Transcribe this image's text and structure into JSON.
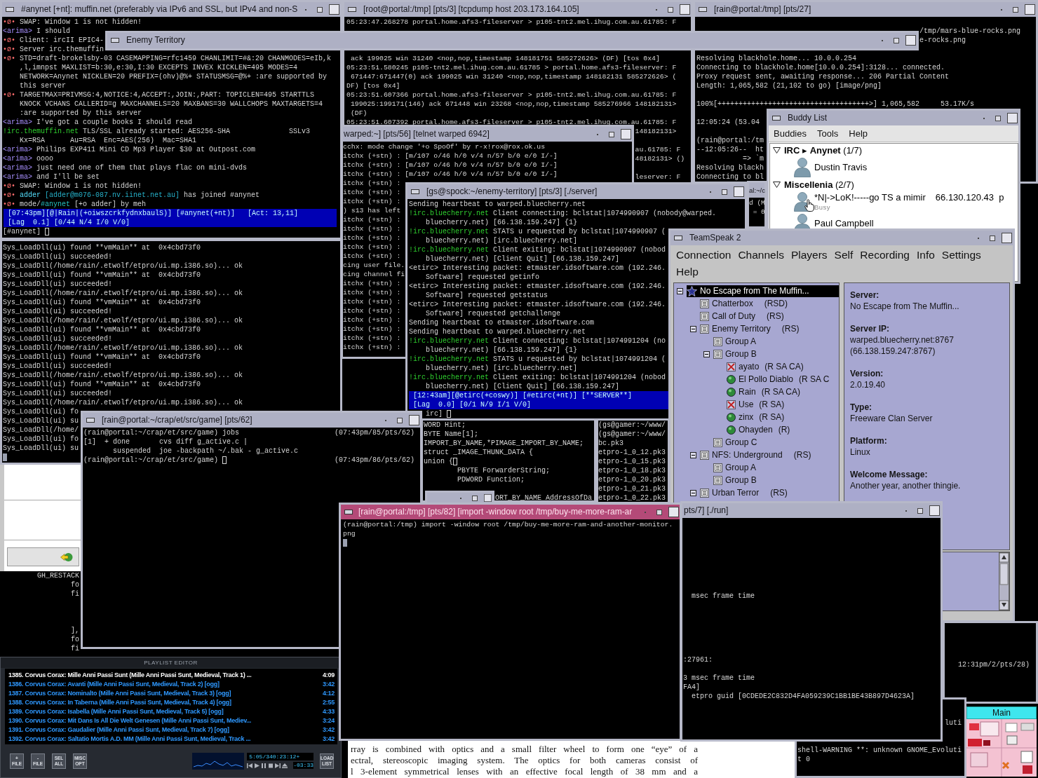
{
  "windows": [
    {
      "kind": "terminal",
      "title": "#anynet [+nt]: muffin.net (preferably via IPv6 and SSL, but IPv4 and non-S",
      "focused": false,
      "lines": [
        [
          {
            "kind": "mark",
            "text": "•ø•"
          },
          {
            "kind": "plain",
            "text": " SWAP: Window 1 is not hidden!"
          }
        ],
        [
          {
            "kind": "nick",
            "text": "<arima>"
          },
          {
            "kind": "plain",
            "text": " I should"
          }
        ],
        [
          {
            "kind": "mark",
            "text": "•ø•"
          },
          {
            "kind": "plain",
            "text": " Client: ircII EPIC4-"
          }
        ],
        [
          {
            "kind": "mark",
            "text": "•ø•"
          },
          {
            "kind": "plain",
            "text": " Server irc.themuffin"
          }
        ],
        [
          {
            "kind": "mark",
            "text": "•ø•"
          },
          {
            "kind": "plain",
            "text": " STD=draft-brokelsby-03 CASEMAPPING=rfc1459 CHANLIMIT=#&:20 CHANMODES=eIb,k"
          }
        ],
        "    ,l,imnpst MAXLIST=b:30,e:30,I:30 EXCEPTS INVEX KICKLEN=495 MODES=4",
        "    NETWORK=Anynet NICKLEN=20 PREFIX=(ohv)@%+ STATUSMSG=@%+ :are supported by",
        "    this server",
        [
          {
            "kind": "mark",
            "text": "•ø•"
          },
          {
            "kind": "plain",
            "text": " TARGETMAX=PRIVMSG:4,NOTICE:4,ACCEPT:,JOIN:,PART: TOPICLEN=495 STARTTLS"
          }
        ],
        "    KNOCK VCHANS CALLERID=g MAXCHANNELS=20 MAXBANS=30 WALLCHOPS MAXTARGETS=4",
        "    :are supported by this server",
        [
          {
            "kind": "nick",
            "text": "<arima>"
          },
          {
            "kind": "plain",
            "text": " I've got a couple books I should read"
          }
        ],
        [
          {
            "kind": "host",
            "text": "!irc.themuffin.net"
          },
          {
            "kind": "plain",
            "text": " TLS/SSL already started: AES256-SHA              SSLv3"
          }
        ],
        "    Kx=RSA      Au=RSA  Enc=AES(256)  Mac=SHA1",
        [
          {
            "kind": "nick",
            "text": "<arima>"
          },
          {
            "kind": "plain",
            "text": " Philips EXP411 Mini CD Mp3 Player $30 at Outpost.com"
          }
        ],
        [
          {
            "kind": "nick",
            "text": "<arima>"
          },
          {
            "kind": "plain",
            "text": " oooo"
          }
        ],
        [
          {
            "kind": "nick",
            "text": "<arima>"
          },
          {
            "kind": "plain",
            "text": " just need one of them that plays flac on mini-dvds"
          }
        ],
        [
          {
            "kind": "nick",
            "text": "<arima>"
          },
          {
            "kind": "plain",
            "text": " and I'll be set"
          }
        ],
        [
          {
            "kind": "mark",
            "text": "•ø•"
          },
          {
            "kind": "plain",
            "text": " SWAP: Window 1 is not hidden!"
          }
        ],
        [
          {
            "kind": "mark",
            "text": "•ø•"
          },
          {
            "kind": "joinnick",
            "text": " adder"
          },
          {
            "kind": "joinhost",
            "text": " [adder@m076-087.nv.iinet.net.au]"
          },
          {
            "kind": "plain",
            "text": " has joined #anynet"
          }
        ],
        [
          {
            "kind": "mark",
            "text": "•ø•"
          },
          {
            "kind": "plain",
            "text": " mode/"
          },
          {
            "kind": "channel",
            "text": "#anynet"
          },
          {
            "kind": "plain",
            "text": " [+o adder] by meh"
          }
        ]
      ],
      "status_bar": [
        "[07:43pm][@|Rain|(+oiwszcrkfydnxbaulS)] [#anynet(+nt)]   [Act: 13,11]",
        "[Lag  0.1] [0/44 N/4 I/0 V/0]"
      ],
      "input": {
        "text": "[#anynet] ",
        "cursor": {
          "kind": "outline"
        }
      }
    },
    {
      "kind": "shaded",
      "title": "Enemy Territory",
      "focused": false
    },
    {
      "kind": "terminal",
      "title": "[root@portal:/tmp] [pts/3] [tcpdump host 203.173.164.105]",
      "focused": false,
      "lines": [
        "05:23:47.268278 portal.home.afs3-fileserver > p105-tnt2.mel.ihug.com.au.61785: F",
        " ack 199025 win 31240 <nop,nop,timestamp 148181751 585272626> (DF) [tos 0x4]",
        "05:23:51.580245 p105-tnt2.mel.ihug.com.au.61785 > portal.home.afs3-fileserver: F",
        " 671447:671447(0) ack 199025 win 31240 <nop,nop,timestamp 148182131 585272626> (",
        "DF) [tos 0x4]",
        "05:23:51.607366 portal.home.afs3-fileserver > p105-tnt2.mel.ihug.com.au.61785: F",
        " 199025:199171(146) ack 671448 win 23268 <nop,nop,timestamp 585276966 148182131>",
        " (DF)",
        "05:23:51.607392 portal.home.afs3-fileserver > p105-tnt2.mel.ihug.com.au.61785: F",
        "148182131>",
        "au.61785: F",
        "48182131> ()",
        "leserver: F"
      ]
    },
    {
      "kind": "terminal",
      "title": "[rain@portal:/tmp] [pts/27]",
      "focused": false,
      "lines": [
        "/tmp/mars-blue-rocks.png",
        "e-rocks.png",
        "Resolving blackhole.home... 10.0.0.254",
        "Connecting to blackhole.home[10.0.0.254]:3128... connected.",
        "Proxy request sent, awaiting response... 206 Partial Content",
        "Length: 1,065,582 (21,102 to go) [image/png]",
        "100%[++++++++++++++++++++++++++++++++++++>] 1,065,582     53.17K/s",
        "12:05:24 (53.04",
        "(rain@portal:/tm",
        "--12:05:26--  ht",
        "           => `m",
        "Resolving blackh",
        "Connecting to bl"
      ]
    },
    {
      "kind": "buddy_list",
      "title": "Buddy List",
      "focused": false,
      "menu": [
        "Buddies",
        "Tools",
        "Help"
      ],
      "groups": [
        {
          "label": "**IRC** ▸ **Anynet** (1/7)",
          "expanded": true,
          "buddies": [
            {
              "name": "Dustin Travis"
            }
          ]
        },
        {
          "label": "**Miscellenia** (2/7)",
          "expanded": true,
          "buddies": [
            {
              "name": "*N|->LoK!-----go TS a mimir",
              "note": "66.130.120.43  p",
              "status": "Busy"
            },
            {
              "name": "Paul Campbell"
            }
          ]
        }
      ]
    },
    {
      "kind": "terminal",
      "title": "warped:~] [pts/56] [telnet warped 6942]",
      "focused": false,
      "lines": [
        "cchx: mode change '+o SpoOf' by r-x!rox@rox.ok.us",
        "itchx (+stn) : [m/107 o/46 h/0 v/4 n/57 b/0 e/0 I/-]",
        "itchx (+stn) : [m/107 o/46 h/0 v/4 n/57 b/0 e/0 I/-]",
        "itchx (+stn) : [m/107 o/46 h/0 v/4 n/57 b/0 e/0 I/-]",
        "itchx (+stn) :",
        "itchx (+stn) :",
        "itchx (+stn) :",
        ") s13 has left",
        "itchx (+stn) :",
        "itchx (+stn) :",
        "itchx (+stn) :",
        "itchx (+stn) :",
        "itchx (+stn) :",
        "cing user file.",
        "cing channel fi",
        "itchx (+stn) :",
        "itchx (+stn) :",
        "itchx (+stn) :",
        "itchx (+stn) :",
        "itchx (+stn) :",
        "itchx (+stn) :",
        "itchx (+stn) :",
        "itchx (+stn) :"
      ]
    },
    {
      "kind": "terminal",
      "title": "[gs@spock:~/enemy-territory] [pts/3] [./server]",
      "focused": false,
      "lines": [
        "Sending heartbeat to warped.bluecherry.net",
        [
          {
            "kind": "host",
            "text": "!irc.bluecherry.net"
          },
          {
            "kind": "plain",
            "text": " Client connecting: bclstat|1074990907 (nobody@warped."
          }
        ],
        "    bluecherry.net) [66.138.159.247] {1}",
        [
          {
            "kind": "host",
            "text": "!irc.bluecherry.net"
          },
          {
            "kind": "plain",
            "text": " STATS u requested by bclstat|1074990907 ("
          }
        ],
        "    bluecherry.net) [irc.bluecherry.net]",
        [
          {
            "kind": "host",
            "text": "!irc.bluecherry.net"
          },
          {
            "kind": "plain",
            "text": " Client exiting: bclstat|1074990907 (nobod"
          }
        ],
        "    bluecherry.net) [Client Quit] [66.138.159.247]",
        "<etirc> Interesting packet: etmaster.idsoftware.com (192.246.",
        "    Software] requested getinfo",
        "<etirc> Interesting packet: etmaster.idsoftware.com (192.246.",
        "    Software] requested getstatus",
        "<etirc> Interesting packet: etmaster.idsoftware.com (192.246.",
        "    Software] requested getchallenge",
        "Sending heartbeat to etmaster.idsoftware.com",
        "Sending heartbeat to warped.bluecherry.net",
        [
          {
            "kind": "host",
            "text": "!irc.bluecherry.net"
          },
          {
            "kind": "plain",
            "text": " Client connecting: bclstat|1074991204 (no"
          }
        ],
        "    bluecherry.net) [66.138.159.247] {1}",
        [
          {
            "kind": "host",
            "text": "!irc.bluecherry.net"
          },
          {
            "kind": "plain",
            "text": " STATS u requested by bclstat|1074991204 ("
          }
        ],
        "    bluecherry.net) [irc.bluecherry.net]",
        [
          {
            "kind": "host",
            "text": "!irc.bluecherry.net"
          },
          {
            "kind": "plain",
            "text": " Client exiting: bclstat|1074991204 (nobod"
          }
        ],
        "    bluecherry.net) [Client Quit] [66.138.159.247]"
      ],
      "status_bar": [
        "[12:43am][@etirc(+coswy)] [#etirc(+nt)] [**SERVER**]",
        "[Lag  0.0] [0/1 N/9 I/1 V/0]"
      ],
      "input": {
        "text": "irc] ",
        "cursor": {
          "kind": "outline"
        }
      }
    },
    {
      "kind": "terminal",
      "title": "al:~/c",
      "focused": false,
      "lines": [
        "d (M",
        "= 0"
      ]
    },
    {
      "kind": "terminal",
      "lines": [
        "Sys_LoadDll(ui) found **vmMain** at  0x4cbd73f0",
        "Sys_LoadDll(ui) succeeded!",
        "Sys_LoadDll(/home/rain/.etwolf/etpro/ui.mp.i386.so)... ok",
        "Sys_LoadDll(ui) found **vmMain** at  0x4cbd73f0",
        "Sys_LoadDll(ui) succeeded!",
        "Sys_LoadDll(/home/rain/.etwolf/etpro/ui.mp.i386.so)... ok",
        "Sys_LoadDll(ui) found **vmMain** at  0x4cbd73f0",
        "Sys_LoadDll(ui) succeeded!",
        "Sys_LoadDll(/home/rain/.etwolf/etpro/ui.mp.i386.so)... ok",
        "Sys_LoadDll(ui) found **vmMain** at  0x4cbd73f0",
        "Sys_LoadDll(ui) succeeded!",
        "Sys_LoadDll(/home/rain/.etwolf/etpro/ui.mp.i386.so)... ok",
        "Sys_LoadDll(ui) found **vmMain** at  0x4cbd73f0",
        "Sys_LoadDll(ui) succeeded!",
        "Sys_LoadDll(/home/rain/.etwolf/etpro/ui.mp.i386.so)... ok",
        "Sys_LoadDll(ui) found **vmMain** at  0x4cbd73f0",
        "Sys_LoadDll(ui) succeeded!",
        "Sys_LoadDll(/home/rain/.etwolf/etpro/ui.mp.i386.so)... ok",
        "Sys_LoadDll(ui) fo",
        "Sys_LoadDll(ui) su",
        "Sys_LoadDll(/home/",
        "Sys_LoadDll(ui) fo",
        "Sys_LoadDll(ui) su",
        {
          "cursor": {
            "kind": "block"
          }
        }
      ]
    },
    {
      "kind": "teamspeak",
      "title": "TeamSpeak 2",
      "focused": false,
      "menu": [
        "Connection",
        "Channels",
        "Players",
        "Self",
        "Recording",
        "Info",
        "Settings",
        "Help"
      ],
      "tree": [
        {
          "kind": "server",
          "name": "No Escape from The Muffin...",
          "selected": true,
          "expanded": true,
          "children": [
            {
              "kind": "channel",
              "name": "Chatterbox",
              "flags": "(RSD)",
              "selected": false
            },
            {
              "kind": "channel",
              "name": "Call of Duty",
              "flags": "(RS)",
              "selected": false
            },
            {
              "kind": "channel",
              "name": "Enemy Territory",
              "flags": "(RS)",
              "selected": false,
              "expanded": true,
              "children": [
                {
                  "kind": "channel",
                  "name": "Group A",
                  "selected": false
                },
                {
                  "kind": "channel",
                  "name": "Group B",
                  "selected": false,
                  "expanded": true,
                  "children": [
                    {
                      "kind": "player",
                      "name": "ayato",
                      "flags": "(R SA CA)",
                      "selected": false,
                      "muted": true
                    },
                    {
                      "kind": "player",
                      "name": "El Pollo Diablo",
                      "flags": "(R SA C",
                      "selected": false,
                      "muted": false
                    },
                    {
                      "kind": "player",
                      "name": "Rain",
                      "flags": "(R SA CA)",
                      "selected": false,
                      "muted": false
                    },
                    {
                      "kind": "player",
                      "name": "Use",
                      "flags": "(R SA)",
                      "selected": false,
                      "muted": true
                    },
                    {
                      "kind": "player",
                      "name": "zinx",
                      "flags": "(R SA)",
                      "selected": false,
                      "muted": false
                    },
                    {
                      "kind": "player",
                      "name": "Ohayden",
                      "flags": "(R)",
                      "selected": false,
                      "muted": false
                    }
                  ]
                },
                {
                  "kind": "channel",
                  "name": "Group C",
                  "selected": false
                }
              ]
            },
            {
              "kind": "channel",
              "name": "NFS: Underground",
              "flags": "(RS)",
              "selected": false,
              "expanded": true,
              "children": [
                {
                  "kind": "channel",
                  "name": "Group A",
                  "selected": false
                },
                {
                  "kind": "channel",
                  "name": "Group B",
                  "selected": false
                }
              ]
            },
            {
              "kind": "channel",
              "name": "Urban Terror",
              "flags": "(RS)",
              "selected": false,
              "expanded": true
            }
          ]
        }
      ],
      "info": [
        {
          "label": "Server:",
          "values": [
            "No Escape from The Muffin..."
          ]
        },
        {
          "label": "Server IP:",
          "values": [
            "warped.bluecherry.net:8767",
            "(66.138.159.247:8767)"
          ]
        },
        {
          "label": "Version:",
          "values": [
            "2.0.19.40"
          ]
        },
        {
          "label": "Type:",
          "values": [
            "Freeware Clan Server"
          ]
        },
        {
          "label": "Platform:",
          "values": [
            "Linux"
          ]
        },
        {
          "label": "Welcome Message:",
          "values": [
            "Another year, another thingie."
          ]
        }
      ]
    },
    {
      "kind": "dialog"
    },
    {
      "kind": "terminal",
      "title": "[rain@portal:~/crap/et/src/game] [pts/62]",
      "focused": false,
      "lines": [
        {
          "text": "(rain@portal:~/crap/et/src/game) jobs",
          "right": "(07:43pm/85/pts/62)"
        },
        "[1]  + done       cvs diff g_active.c |",
        "       suspended  joe -backpath ~/.bak - g_active.c",
        {
          "text": "(rain@portal:~/crap/et/src/game) ",
          "cursor": {
            "kind": "outline"
          },
          "right": "(07:43pm/86/pts/62)"
        }
      ]
    },
    {
      "kind": "terminal",
      "lines": [
        "WORD Hint;",
        "BYTE Name[1];",
        "IMPORT_BY_NAME,*PIMAGE_IMPORT_BY_NAME;",
        "struct _IMAGE_THUNK_DATA {",
        {
          "text": "union {",
          "cursor": {
            "kind": "outline"
          }
        },
        "PBYTE ForwarderString;",
        "PDWORD Function;",
        "ORT_BY_NAME AddressOfDa"
      ]
    },
    {
      "kind": "terminal",
      "lines": [
        "(gs@gamer:~/www/",
        "(gs@gamer:~/www/",
        "bc.pk3",
        "etpro-1_0_12.pk3",
        "etpro-1_0_15.pk3",
        "etpro-1_0_18.pk3",
        "etpro-1_0_20.pk3",
        "etpro-1_0_21.pk3",
        "etpro-1_0_22.pk3"
      ]
    },
    {
      "kind": "shaded",
      "focused": false
    },
    {
      "kind": "terminal",
      "title": "[rain@portal:/tmp] [pts/82] [import -window root /tmp/buy-me-more-ram-ar",
      "focused": true,
      "lines": [
        "(rain@portal:/tmp) import -window root /tmp/buy-me-more-ram-and-another-monitor.",
        "png",
        {
          "cursor": {
            "kind": "block"
          }
        }
      ]
    },
    {
      "kind": "terminal",
      "title": "pts/7] [./run]",
      "focused": false,
      "lines": [
        "msec frame time",
        ":27961:",
        "3 msec frame time",
        "FA4]",
        "etpro guid [0CDEDE2C832D4FA059239C1BB1BE43B897D4623A]"
      ]
    },
    {
      "kind": "terminal",
      "lines": [
        "GH_RESTACK",
        "fo",
        "fi",
        "],",
        "fo",
        "fi"
      ]
    },
    {
      "kind": "playlist",
      "title": "PLAYLIST EDITOR",
      "entries": [
        {
          "title": "1385. Corvus Corax: Mille Anni Passi Sunt (Mille Anni Passi Sunt, Medieval, Track 1) ...",
          "time": "4:09",
          "selected": true
        },
        {
          "title": "1386. Corvus Corax: Avanti (Mille Anni Passi Sunt, Medieval, Track 2) [ogg]",
          "time": "3:42",
          "selected": false
        },
        {
          "title": "1387. Corvus Corax: Nominalto (Mille Anni Passi Sunt, Medieval, Track 3) [ogg]",
          "time": "4:12",
          "selected": false
        },
        {
          "title": "1388. Corvus Corax: In Taberna (Mille Anni Passi Sunt, Medieval, Track 4) [ogg]",
          "time": "2:55",
          "selected": false
        },
        {
          "title": "1389. Corvus Corax: Isabella (Mille Anni Passi Sunt, Medieval, Track 5) [ogg]",
          "time": "4:33",
          "selected": false
        },
        {
          "title": "1390. Corvus Corax: Mit Dans Is All Die Welt Genesen (Mille Anni Passi Sunt, Mediev...",
          "time": "3:24",
          "selected": false
        },
        {
          "title": "1391. Corvus Corax: Gaudalier (Mille Anni Passi Sunt, Medieval, Track 7) [ogg]",
          "time": "3:42",
          "selected": false
        },
        {
          "title": "1392. Corvus Corax: Saltatio Mortis A.D. MM (Mille Anni Passi Sunt, Medieval, Track ...",
          "time": "3:42",
          "selected": false
        }
      ],
      "buttons": [
        "+ FILE",
        "- FILE",
        "SEL ALL",
        "MISC OPT"
      ],
      "time": "5:05/340:23:12+",
      "remaining": "-03:33",
      "load_button": "LOAD LIST"
    },
    {
      "kind": "terminal",
      "lines": [
        "12:31pm/2/pts/28)"
      ]
    },
    {
      "kind": "terminal",
      "lines": [
        "luti",
        "shell-WARNING **: unknown GNOME_Evoluti",
        "t 0"
      ]
    },
    {
      "kind": "document",
      "lines": [
        "rray is combined with optics and a small filter wheel to form one “eye” of a",
        "ectral, stereoscopic imaging system. The optics for both cameras consist of",
        "l 3-element symmetrical lenses with an effective focal length of 38 mm and a"
      ]
    },
    {
      "kind": "pager",
      "label": "Main"
    }
  ]
}
